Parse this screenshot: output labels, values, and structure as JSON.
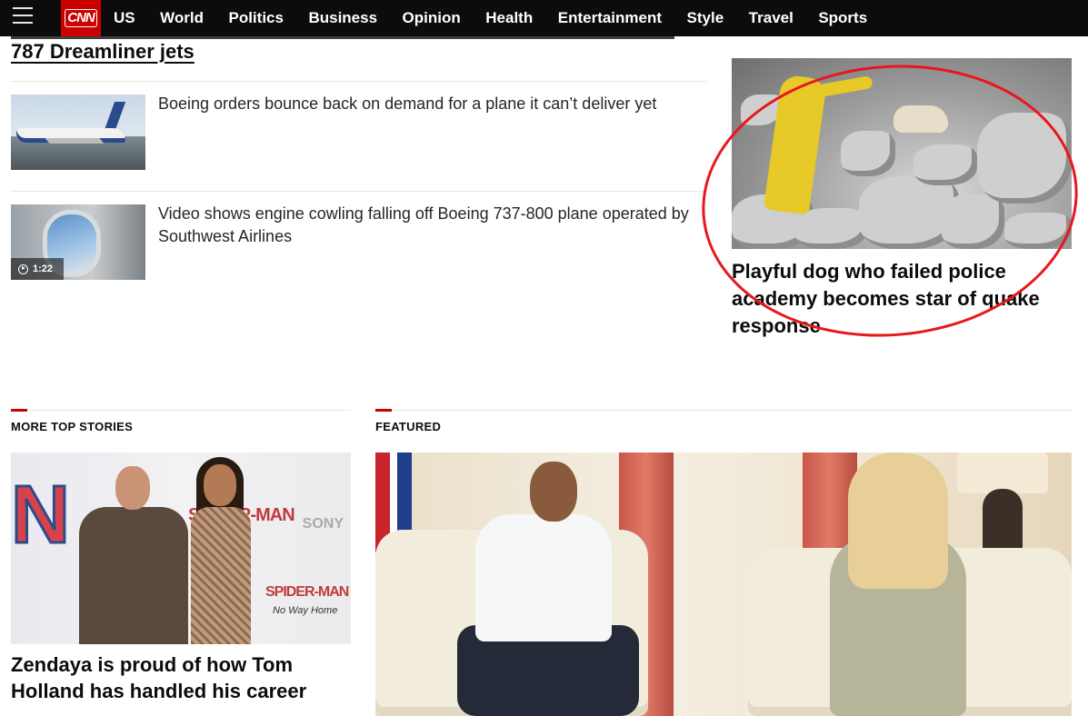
{
  "nav": {
    "logo": "CNN",
    "links": [
      "US",
      "World",
      "Politics",
      "Business",
      "Opinion",
      "Health",
      "Entertainment",
      "Style",
      "Travel",
      "Sports"
    ]
  },
  "top": {
    "headline": "787 Dreamliner jets",
    "stories": [
      {
        "title": "Boeing orders bounce back on demand for a plane it can’t deliver yet",
        "thumb": "boeing-plane"
      },
      {
        "title": "Video shows engine cowling falling off Boeing 737-800 plane operated by Southwest Airlines",
        "thumb": "plane-window",
        "video_duration": "1:22"
      }
    ]
  },
  "feature": {
    "title": "Playful dog who failed police academy becomes star of quake response",
    "highlight_color": "#e8171d"
  },
  "sections": {
    "more_top_stories": {
      "label": "MORE TOP STORIES",
      "card_title": "Zendaya is proud of how Tom Holland has handled his career",
      "image_text": {
        "letter": "N",
        "spider_top": "SPIDER-MAN",
        "sony": "SONY",
        "spider_bottom": "SPIDER-MAN",
        "subtitle": "No Way Home"
      }
    },
    "featured": {
      "label": "FEATURED"
    }
  },
  "colors": {
    "brand": "#cc0000",
    "nav_bg": "#0c0c0c"
  }
}
